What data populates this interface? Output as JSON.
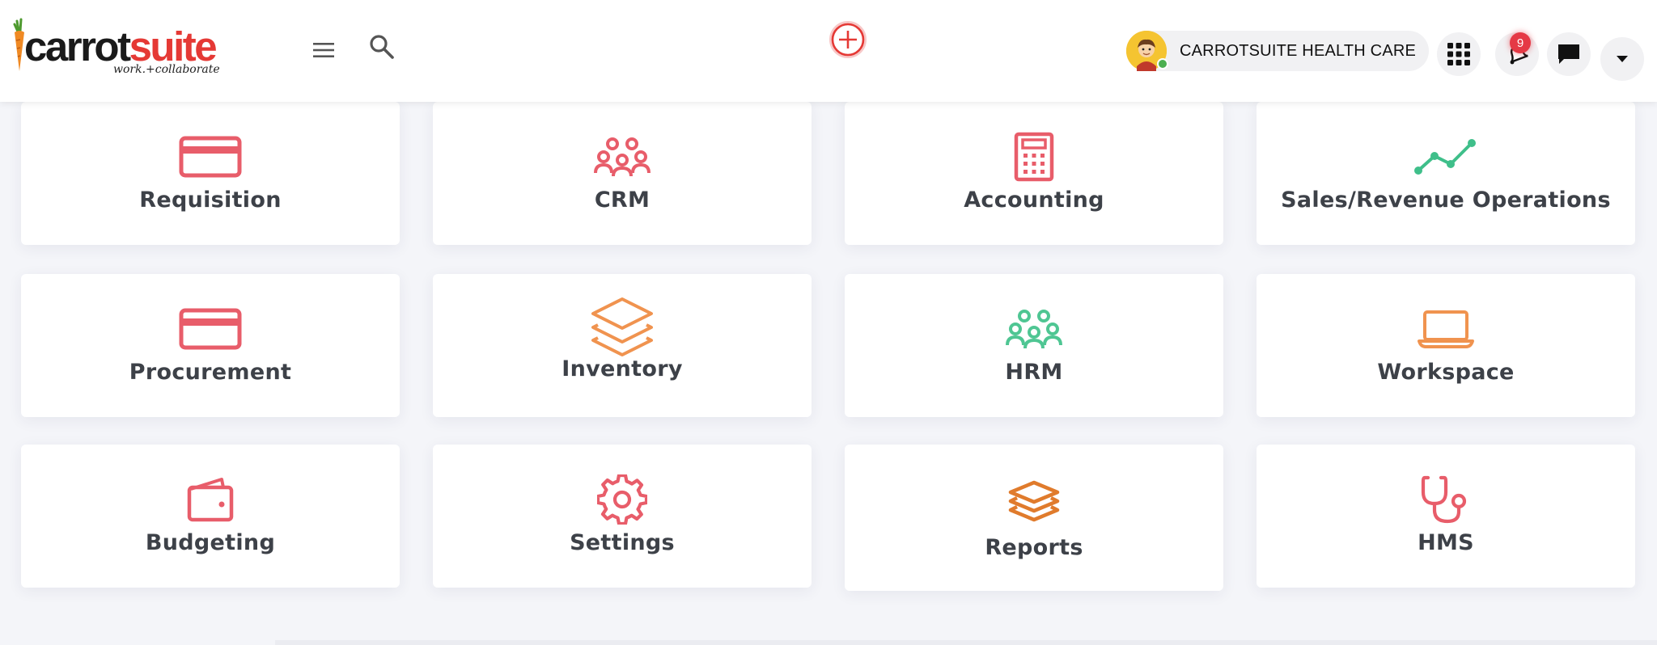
{
  "brand": {
    "name_part1": "carrot",
    "name_part2": "suite",
    "tagline": "work.+collaborate"
  },
  "header": {
    "company_name": "CARROTSUITE HEALTH CARE",
    "notification_count": "9"
  },
  "modules": [
    {
      "label": "Requisition",
      "icon": "credit-card-icon",
      "color": "#e85d6a"
    },
    {
      "label": "CRM",
      "icon": "people-group-icon",
      "color": "#e85d6a"
    },
    {
      "label": "Accounting",
      "icon": "calculator-icon",
      "color": "#e85d6a"
    },
    {
      "label": "Sales/Revenue Operations",
      "icon": "line-chart-icon",
      "color": "#3fbf8a"
    },
    {
      "label": "Procurement",
      "icon": "credit-card-icon",
      "color": "#e85d6a"
    },
    {
      "label": "Inventory",
      "icon": "layers-icon",
      "color": "#f0934f"
    },
    {
      "label": "HRM",
      "icon": "people-group-icon",
      "color": "#4fc693"
    },
    {
      "label": "Workspace",
      "icon": "laptop-icon",
      "color": "#f0934f"
    },
    {
      "label": "Budgeting",
      "icon": "wallet-icon",
      "color": "#e85d6a"
    },
    {
      "label": "Settings",
      "icon": "gear-icon",
      "color": "#e85d6a"
    },
    {
      "label": "Reports",
      "icon": "stacked-layers-icon",
      "color": "#e07b2c"
    },
    {
      "label": "HMS",
      "icon": "stethoscope-icon",
      "color": "#e85d6a"
    }
  ]
}
